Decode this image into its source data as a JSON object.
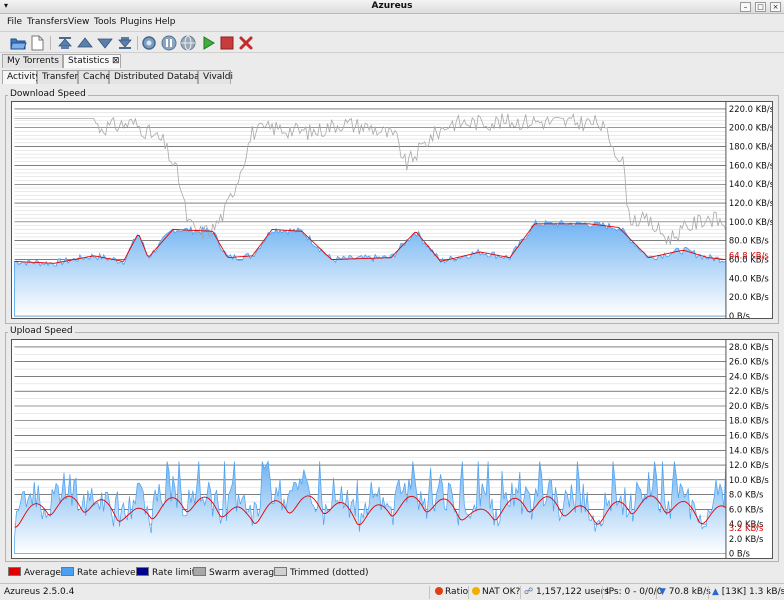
{
  "window": {
    "title": "Azureus"
  },
  "menu": [
    "File",
    "Transfers",
    "View",
    "Tools",
    "Plugins",
    "Help"
  ],
  "toolbar_icons": [
    "open-folder-icon",
    "new-document-icon",
    "move-top-icon",
    "move-up-icon",
    "move-down-icon",
    "move-bottom-icon",
    "refresh-icon",
    "pause-icon",
    "globe-icon",
    "start-icon",
    "stop-icon",
    "remove-icon"
  ],
  "main_tabs": [
    {
      "label": "My Torrents"
    },
    {
      "label": "Statistics",
      "close": "⊠"
    }
  ],
  "sub_tabs": [
    "Activity",
    "Transfers",
    "Cache",
    "Distributed Database",
    "Vivaldi"
  ],
  "download": {
    "group_label": "Download Speed",
    "ticks": [
      "220.0 KB/s",
      "200.0 KB/s",
      "180.0 KB/s",
      "160.0 KB/s",
      "140.0 KB/s",
      "120.0 KB/s",
      "100.0 KB/s",
      "80.0 KB/s",
      "60.0 KB/s",
      "40.0 KB/s",
      "20.0 KB/s",
      "0 B/s"
    ],
    "current_label": "64.8 KB/s"
  },
  "upload": {
    "group_label": "Upload Speed",
    "ticks": [
      "28.0 KB/s",
      "26.0 KB/s",
      "24.0 KB/s",
      "22.0 KB/s",
      "20.0 KB/s",
      "18.0 KB/s",
      "16.0 KB/s",
      "14.0 KB/s",
      "12.0 KB/s",
      "10.0 KB/s",
      "8.0 KB/s",
      "6.0 KB/s",
      "4.0 KB/s",
      "2.0 KB/s",
      "0 B/s"
    ],
    "current_label": "3.2 KB/s"
  },
  "legend": [
    {
      "label": "Average",
      "color": "#e00000"
    },
    {
      "label": "Rate achieved",
      "color": "#4aa0f0"
    },
    {
      "label": "Rate limit",
      "color": "#000090"
    },
    {
      "label": "Swarm average",
      "color": "#a8a8a8"
    },
    {
      "label": "Trimmed (dotted)",
      "color": "#d0d0d0"
    }
  ],
  "status": {
    "version": "Azureus 2.5.0.4",
    "ratio_label": "Ratio",
    "nat_label": "NAT OK?",
    "users": "1,157,122 users",
    "ips": "IPs: 0 - 0/0/0",
    "down_speed": "70.8 kB/s",
    "up_speed": "[13K] 1.3 kB/s"
  },
  "colors": {
    "average": "#e00000",
    "achieved": "#4aa0f0",
    "fill_top": "#6fb2f2",
    "fill_bottom": "#ffffff",
    "swarm": "#a8a8a8",
    "grid": "#303030"
  }
}
